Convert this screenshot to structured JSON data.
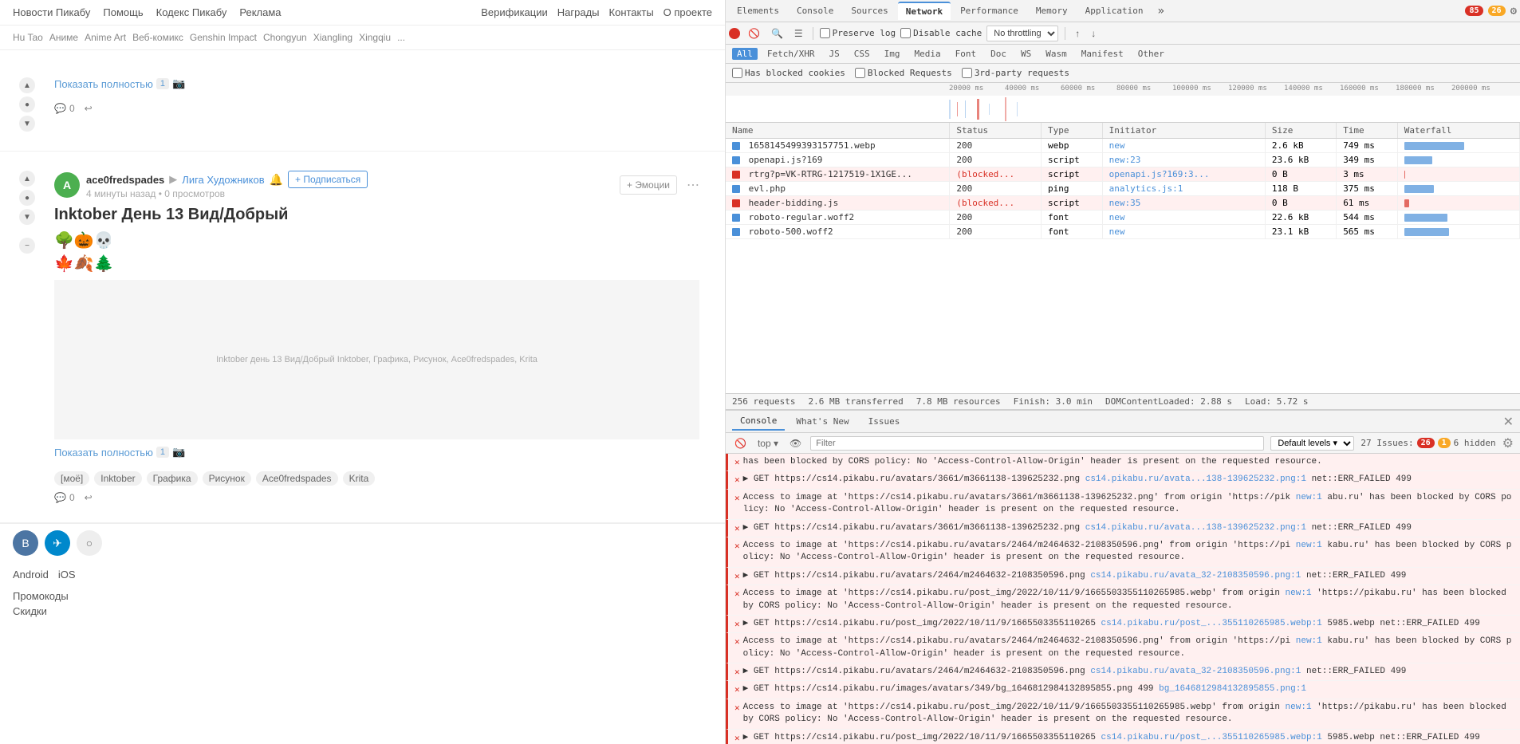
{
  "site": {
    "nav": {
      "links": [
        "Новости Пикабу",
        "Помощь",
        "Кодекс Пикабу",
        "Реклама"
      ],
      "right_links": [
        "Верификации",
        "Награды",
        "Контакты",
        "О проекте"
      ],
      "tags": [
        "Hu Tao",
        "Аниме",
        "Anime Art",
        "Веб-комикс",
        "Genshin Impact",
        "Chongyun",
        "Xiangling",
        "Xingqiu"
      ],
      "more": "...",
      "android": "Android",
      "ios": "iOS",
      "promocodes": "Промокоды",
      "discounts": "Скидки"
    },
    "post1": {
      "show_full": "Показать полностью",
      "show_full_count": "1",
      "comments": "0",
      "share_icon": "↩"
    },
    "post2": {
      "author": "ace0fredspades",
      "community": "Лига Художников",
      "subscribe": "+ Подписаться",
      "time": "4 минуты назад",
      "views": "0 просмотров",
      "title": "Inktober День 13 Вид/Добрый",
      "emoji_btn": "+ Эмоции",
      "emoji_row1": "🌳🎃💀",
      "emoji_row2": "🍁🍂🌲",
      "show_full": "Показать полностью",
      "show_full_count": "1",
      "comments": "0",
      "image_alt": "Inktober день 13 Вид/Добрый Inktober, Графика, Рисунок, Ace0fredspades, Krita",
      "tags": [
        "[моё]",
        "Inktober",
        "Графика",
        "Рисунок",
        "Ace0fredspades",
        "Krita"
      ]
    }
  },
  "devtools": {
    "tabs": [
      "Elements",
      "Console",
      "Sources",
      "Network",
      "Performance",
      "Memory",
      "Application"
    ],
    "more_tabs": "»",
    "badge_red": "85",
    "badge_yellow": "26",
    "gear_label": "⚙",
    "network_toolbar": {
      "record": "●",
      "clear": "🚫",
      "search": "🔍",
      "filter_icon": "☰",
      "preserve_log": "Preserve log",
      "disable_cache": "Disable cache",
      "throttling": "No throttling",
      "import": "↑",
      "export": "↓"
    },
    "filter_row": {
      "has_blocked": "Has blocked cookies",
      "blocked_requests": "Blocked Requests",
      "third_party": "3rd-party requests"
    },
    "filter_types": [
      "Fetch/XHR",
      "JS",
      "CSS",
      "Img",
      "Media",
      "Font",
      "Doc",
      "WS",
      "Wasm",
      "Manifest",
      "Other"
    ],
    "filter_types_all": "All",
    "timeline": {
      "ticks": [
        "20000 ms",
        "40000 ms",
        "60000 ms",
        "80000 ms",
        "100000 ms",
        "120000 ms",
        "140000 ms",
        "160000 ms",
        "180000 ms",
        "200000 ms"
      ]
    },
    "table": {
      "headers": [
        "Name",
        "Status",
        "Type",
        "Initiator",
        "Size",
        "Time",
        "Waterfall"
      ],
      "rows": [
        {
          "name": "1658145499393157751.webp",
          "status": "200",
          "type": "webp",
          "initiator": "new",
          "size": "2.6 kB",
          "time": "749 ms",
          "blocked": false
        },
        {
          "name": "openapi.js?169",
          "status": "200",
          "type": "script",
          "initiator": "new:23",
          "size": "23.6 kB",
          "time": "349 ms",
          "blocked": false
        },
        {
          "name": "rtrg?p=VK-RTRG-1217519-1X1GE...",
          "status": "(blocked...",
          "type": "script",
          "initiator": "openapi.js?169:3...",
          "size": "0 B",
          "time": "3 ms",
          "blocked": true
        },
        {
          "name": "evl.php",
          "status": "200",
          "type": "ping",
          "initiator": "analytics.js:1",
          "size": "118 B",
          "time": "375 ms",
          "blocked": false
        },
        {
          "name": "header-bidding.js",
          "status": "(blocked...",
          "type": "script",
          "initiator": "new:35",
          "size": "0 B",
          "time": "61 ms",
          "blocked": true
        },
        {
          "name": "roboto-regular.woff2",
          "status": "200",
          "type": "font",
          "initiator": "new",
          "size": "22.6 kB",
          "time": "544 ms",
          "blocked": false
        },
        {
          "name": "roboto-500.woff2",
          "status": "200",
          "type": "font",
          "initiator": "new",
          "size": "23.1 kB",
          "time": "565 ms",
          "blocked": false
        }
      ]
    },
    "summary": {
      "requests": "256 requests",
      "transferred": "2.6 MB transferred",
      "resources": "7.8 MB resources",
      "finish": "Finish: 3.0 min",
      "dom_loaded": "DOMContentLoaded: 2.88 s",
      "load": "Load: 5.72 s"
    },
    "console": {
      "tabs": [
        "Console",
        "What's New",
        "Issues"
      ],
      "active_tab": "Console",
      "issues_count": "27 Issues:",
      "issues_badge_red": "26",
      "issues_badge_yellow": "1",
      "issues_hidden": "6 hidden",
      "level_select": "Default levels ▾",
      "filter_placeholder": "Filter",
      "top_context": "top ▾",
      "messages": [
        {
          "type": "error",
          "text": "has been blocked by CORS policy: No 'Access-Control-Allow-Origin' header is present on the requested resource.",
          "source": ""
        },
        {
          "type": "error",
          "expandable": true,
          "text": "GET https://cs14.pikabu.ru/avatars/3661/m3661138-139625232.png",
          "link_text": "cs14.pikabu.ru/avata...138-139625232.png:1",
          "extra": "net::ERR_FAILED 499",
          "source": ""
        },
        {
          "type": "error",
          "text": "Access to image at 'https://cs14.pikabu.ru/avatars/3661/m3661138-139625232.png' from origin 'https://pik",
          "link1": "new:1",
          "extra2": "abu.ru' has been blocked by CORS policy: No 'Access-Control-Allow-Origin' header is present on the requested resource.",
          "source": ""
        },
        {
          "type": "error",
          "expandable": true,
          "text": "GET https://cs14.pikabu.ru/avatars/3661/m3661138-139625232.png",
          "link_text": "cs14.pikabu.ru/avata...138-139625232.png:1",
          "extra": "net::ERR_FAILED 499",
          "source": ""
        },
        {
          "type": "error",
          "text": "Access to image at 'https://cs14.pikabu.ru/avatars/2464/m2464632-2108350596.png' from origin 'https://pi",
          "link2": "new:1",
          "extra2": "kabu.ru' has been blocked by CORS policy: No 'Access-Control-Allow-Origin' header is present on the requested resource.",
          "source": ""
        },
        {
          "type": "error",
          "expandable": true,
          "text": "GET https://cs14.pikabu.ru/avatars/2464/m2464632-2108350596.png",
          "link_text": "cs14.pikabu.ru/avata_32-2108350596.png:1",
          "extra": "net::ERR_FAILED 499",
          "source": ""
        },
        {
          "type": "error",
          "text": "Access to image at 'https://cs14.pikabu.ru/post_img/2022/10/11/9/1665503355110265985.webp' from origin",
          "link3": "new:1",
          "extra2": "'https://pikabu.ru' has been blocked by CORS policy: No 'Access-Control-Allow-Origin' header is present on the requested resource.",
          "source": ""
        },
        {
          "type": "error",
          "expandable": true,
          "text": "GET https://cs14.pikabu.ru/post_img/2022/10/11/9/1665503355110265",
          "link_text": "cs14.pikabu.ru/post_...355110265985.webp:1",
          "extra": "5985.webp net::ERR_FAILED 499",
          "source": ""
        },
        {
          "type": "error",
          "text": "Access to image at 'https://cs14.pikabu.ru/avatars/2464/m2464632-2108350596.png' from origin 'https://pi",
          "link4": "new:1",
          "extra2": "kabu.ru' has been blocked by CORS policy: No 'Access-Control-Allow-Origin' header is present on the requested resource.",
          "source": ""
        },
        {
          "type": "error",
          "expandable": true,
          "text": "GET https://cs14.pikabu.ru/avatars/2464/m2464632-2108350596.png",
          "link_text": "cs14.pikabu.ru/avata_32-2108350596.png:1",
          "extra": "net::ERR_FAILED 499",
          "source": ""
        },
        {
          "type": "error",
          "expandable": true,
          "text": "GET https://cs14.pikabu.ru/images/avatars/349/bg_1646812984132895855.png 499",
          "link_text": "bg_1646812984132895855.png:1",
          "source": ""
        },
        {
          "type": "error",
          "text": "Access to image at 'https://cs14.pikabu.ru/post_img/2022/10/11/9/1665503355110265985.webp' from origin",
          "link5": "new:1",
          "extra2": "'https://pikabu.ru' has been blocked by CORS policy: No 'Access-Control-Allow-Origin' header is present on the requested resource.",
          "source": ""
        },
        {
          "type": "error",
          "expandable": true,
          "text": "GET https://cs14.pikabu.ru/post_img/2022/10/11/9/1665503355110265",
          "link_text": "cs14.pikabu.ru/post_...355110265985.webp:1",
          "extra": "5985.webp net::ERR_FAILED 499",
          "source": ""
        }
      ]
    }
  }
}
